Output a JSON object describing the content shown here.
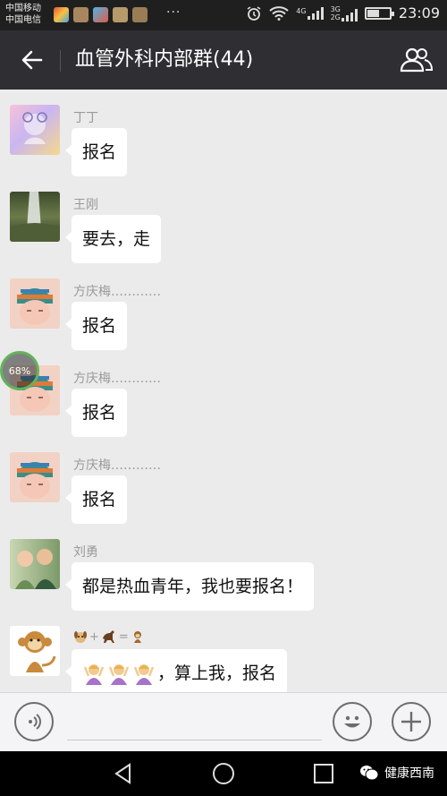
{
  "status_bar": {
    "carrier_1": "中国移动",
    "carrier_2": "中国电信",
    "more_indicator": "···",
    "network_1": "4G",
    "network_2a": "3G",
    "network_2b": "2G",
    "battery_level": 0.55,
    "time": "23:09"
  },
  "header": {
    "title": "血管外科内部群(44)",
    "back_icon": "arrow-left-icon",
    "members_icon": "group-members-icon"
  },
  "messages": [
    {
      "sender": "丁丁",
      "text": "报名",
      "avatar": "cartoon-avatar"
    },
    {
      "sender": "王刚",
      "text": "要去，走",
      "avatar": "waterfall-avatar"
    },
    {
      "sender": "方庆梅…………",
      "text": "报名",
      "avatar": "baby-avatar"
    },
    {
      "sender": "方庆梅…………",
      "text": "报名",
      "avatar": "baby-avatar"
    },
    {
      "sender": "方庆梅…………",
      "text": "报名",
      "avatar": "baby-avatar"
    },
    {
      "sender": "刘勇",
      "text": "都是热血青年，我也要报名！",
      "avatar": "kids-avatar"
    },
    {
      "sender_symbols": [
        "+",
        "="
      ],
      "text": "，算上我，报名",
      "avatar": "monkey-avatar"
    }
  ],
  "overlay": {
    "progress_text": "68%",
    "progress": 0.68
  },
  "input_bar": {
    "voice_icon": "voice-icon",
    "emoji_icon": "emoji-icon",
    "plus_icon": "plus-icon"
  },
  "nav_bar": {
    "watermark": "健康西南"
  }
}
